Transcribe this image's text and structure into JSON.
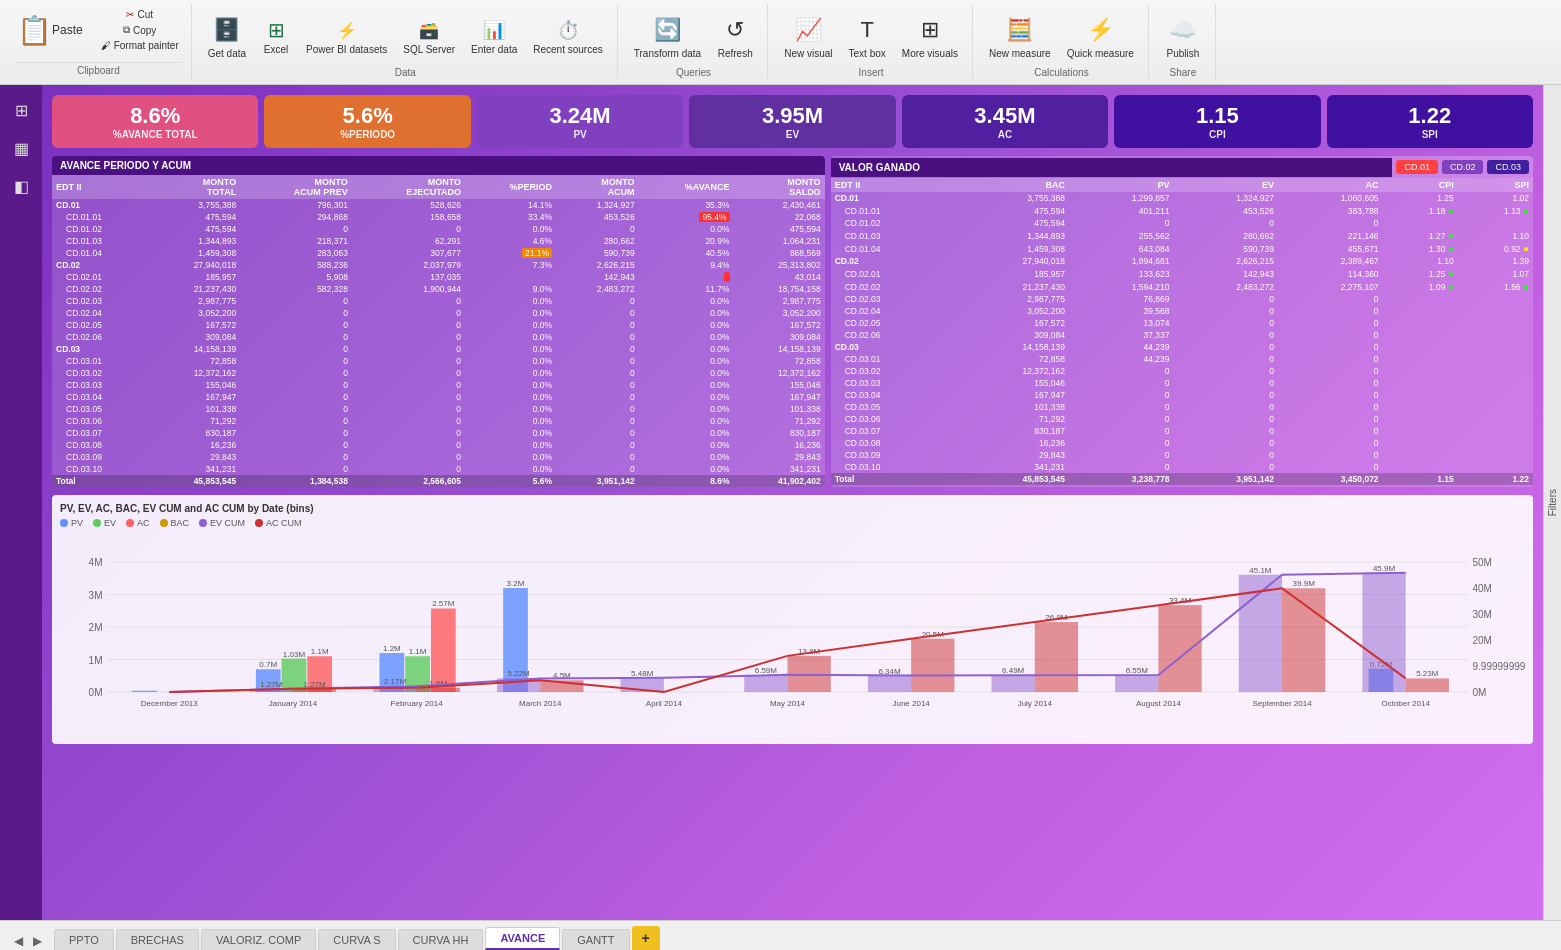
{
  "toolbar": {
    "clipboard_group": "Clipboard",
    "paste_label": "Paste",
    "cut_label": "Cut",
    "copy_label": "Copy",
    "format_painter_label": "Format painter",
    "data_group": "Data",
    "get_data_label": "Get\ndata",
    "excel_label": "Excel",
    "power_bi_label": "Power BI\ndatasets",
    "sql_label": "SQL\nServer",
    "enter_data_label": "Enter\ndata",
    "recent_sources_label": "Recent\nsources",
    "queries_group": "Queries",
    "transform_label": "Transform\ndata",
    "refresh_label": "Refresh",
    "insert_group": "Insert",
    "new_visual_label": "New\nvisual",
    "text_box_label": "Text\nbox",
    "more_visuals_label": "More\nvisuals",
    "calculations_group": "Calculations",
    "new_measure_label": "New\nmeasure",
    "quick_measure_label": "Quick\nmeasure",
    "share_group": "Share",
    "publish_label": "Publish",
    "filters_label": "Filters"
  },
  "kpis": [
    {
      "value": "8.6%",
      "label": "%AVANCE TOTAL",
      "style": "pink"
    },
    {
      "value": "5.6%",
      "label": "%PERIODO",
      "style": "orange"
    },
    {
      "value": "3.24M",
      "label": "PV",
      "style": "purple-light"
    },
    {
      "value": "3.95M",
      "label": "EV",
      "style": "purple-mid"
    },
    {
      "value": "3.45M",
      "label": "AC",
      "style": "purple-dark"
    },
    {
      "value": "1.15",
      "label": "CPI",
      "style": "deep"
    },
    {
      "value": "1.22",
      "label": "SPI",
      "style": "deep"
    }
  ],
  "left_table": {
    "title": "AVANCE PERIODO Y ACUM",
    "headers": [
      "EDT II",
      "MONTO TOTAL",
      "MONTO ACUM PREV",
      "MONTO EJECUTADO",
      "%PERIOD",
      "MONTO ACUM",
      "%AVANCE",
      "MONTO SALDO"
    ],
    "rows": [
      {
        "id": "CD.01",
        "total": "3,755,388",
        "acum_prev": "796,301",
        "ejecutado": "528,626",
        "period": "14.1%",
        "acum": "1,324,927",
        "avance": "35.3%",
        "saldo": "2,430,461",
        "level": 0
      },
      {
        "id": "CD.01.01",
        "total": "475,594",
        "acum_prev": "294,868",
        "ejecutado": "158,658",
        "period": "33.4%",
        "acum": "453,526",
        "avance": "95.4%",
        "saldo": "22,068",
        "level": 1,
        "badge_avance": "red"
      },
      {
        "id": "CD.01.02",
        "total": "475,594",
        "acum_prev": "0",
        "ejecutado": "0",
        "period": "0.0%",
        "acum": "0",
        "avance": "0.0%",
        "saldo": "475,594",
        "level": 1
      },
      {
        "id": "CD.01.03",
        "total": "1,344,893",
        "acum_prev": "218,371",
        "ejecutado": "62,291",
        "period": "4.6%",
        "acum": "280,662",
        "avance": "20.9%",
        "saldo": "1,064,231",
        "level": 1
      },
      {
        "id": "CD.01.04",
        "total": "1,459,308",
        "acum_prev": "283,063",
        "ejecutado": "307,677",
        "period": "21.1%",
        "acum": "590,739",
        "avance": "40.5%",
        "saldo": "868,569",
        "level": 1,
        "badge_period": "orange"
      },
      {
        "id": "CD.02",
        "total": "27,940,018",
        "acum_prev": "588,236",
        "ejecutado": "2,037,979",
        "period": "7.3%",
        "acum": "2,626,215",
        "avance": "9.4%",
        "saldo": "25,313,802",
        "level": 0
      },
      {
        "id": "CD.02.01",
        "total": "185,957",
        "acum_prev": "5,908",
        "ejecutado": "137,035",
        "period": "",
        "acum": "142,943",
        "avance": "",
        "saldo": "43,014",
        "level": 1,
        "badge_avance": "red"
      },
      {
        "id": "CD.02.02",
        "total": "21,237,430",
        "acum_prev": "582,328",
        "ejecutado": "1,900,944",
        "period": "9.0%",
        "acum": "2,483,272",
        "avance": "11.7%",
        "saldo": "18,754,158",
        "level": 1
      },
      {
        "id": "CD.02.03",
        "total": "2,987,775",
        "acum_prev": "0",
        "ejecutado": "0",
        "period": "0.0%",
        "acum": "0",
        "avance": "0.0%",
        "saldo": "2,987,775",
        "level": 1
      },
      {
        "id": "CD.02.04",
        "total": "3,052,200",
        "acum_prev": "0",
        "ejecutado": "0",
        "period": "0.0%",
        "acum": "0",
        "avance": "0.0%",
        "saldo": "3,052,200",
        "level": 1
      },
      {
        "id": "CD.02.05",
        "total": "167,572",
        "acum_prev": "0",
        "ejecutado": "0",
        "period": "0.0%",
        "acum": "0",
        "avance": "0.0%",
        "saldo": "167,572",
        "level": 1
      },
      {
        "id": "CD.02.06",
        "total": "309,084",
        "acum_prev": "0",
        "ejecutado": "0",
        "period": "0.0%",
        "acum": "0",
        "avance": "0.0%",
        "saldo": "309,084",
        "level": 1
      },
      {
        "id": "CD.03",
        "total": "14,158,139",
        "acum_prev": "0",
        "ejecutado": "0",
        "period": "0.0%",
        "acum": "0",
        "avance": "0.0%",
        "saldo": "14,158,139",
        "level": 0
      },
      {
        "id": "CD.03.01",
        "total": "72,858",
        "acum_prev": "0",
        "ejecutado": "0",
        "period": "0.0%",
        "acum": "0",
        "avance": "0.0%",
        "saldo": "72,858",
        "level": 1
      },
      {
        "id": "CD.03.02",
        "total": "12,372,162",
        "acum_prev": "0",
        "ejecutado": "0",
        "period": "0.0%",
        "acum": "0",
        "avance": "0.0%",
        "saldo": "12,372,162",
        "level": 1
      },
      {
        "id": "CD.03.03",
        "total": "155,046",
        "acum_prev": "0",
        "ejecutado": "0",
        "period": "0.0%",
        "acum": "0",
        "avance": "0.0%",
        "saldo": "155,046",
        "level": 1
      },
      {
        "id": "CD.03.04",
        "total": "167,947",
        "acum_prev": "0",
        "ejecutado": "0",
        "period": "0.0%",
        "acum": "0",
        "avance": "0.0%",
        "saldo": "167,947",
        "level": 1
      },
      {
        "id": "CD.03.05",
        "total": "101,338",
        "acum_prev": "0",
        "ejecutado": "0",
        "period": "0.0%",
        "acum": "0",
        "avance": "0.0%",
        "saldo": "101,338",
        "level": 1
      },
      {
        "id": "CD.03.06",
        "total": "71,292",
        "acum_prev": "0",
        "ejecutado": "0",
        "period": "0.0%",
        "acum": "0",
        "avance": "0.0%",
        "saldo": "71,292",
        "level": 1
      },
      {
        "id": "CD.03.07",
        "total": "830,187",
        "acum_prev": "0",
        "ejecutado": "0",
        "period": "0.0%",
        "acum": "0",
        "avance": "0.0%",
        "saldo": "830,187",
        "level": 1
      },
      {
        "id": "CD.03.08",
        "total": "16,236",
        "acum_prev": "0",
        "ejecutado": "0",
        "period": "0.0%",
        "acum": "0",
        "avance": "0.0%",
        "saldo": "16,236",
        "level": 1
      },
      {
        "id": "CD.03.09",
        "total": "29,843",
        "acum_prev": "0",
        "ejecutado": "0",
        "period": "0.0%",
        "acum": "0",
        "avance": "0.0%",
        "saldo": "29,843",
        "level": 1
      },
      {
        "id": "CD.03.10",
        "total": "341,231",
        "acum_prev": "0",
        "ejecutado": "0",
        "period": "0.0%",
        "acum": "0",
        "avance": "0.0%",
        "saldo": "341,231",
        "level": 1
      }
    ],
    "total_row": {
      "id": "Total",
      "total": "45,853,545",
      "acum_prev": "1,384,538",
      "ejecutado": "2,566,605",
      "period": "5.6%",
      "acum": "3,951,142",
      "avance": "8.6%",
      "saldo": "41,902,402"
    }
  },
  "right_table": {
    "title": "VALOR GANADO",
    "cd_buttons": [
      "CD.01",
      "CD.02",
      "CD.03"
    ],
    "headers": [
      "EDT II",
      "BAC",
      "PV",
      "EV",
      "AC",
      "CPI",
      "SPI"
    ],
    "rows": [
      {
        "id": "CD.01",
        "bac": "3,755,388",
        "pv": "1,299,857",
        "ev": "1,324,927",
        "ac": "1,060,605",
        "cpi": "1.25",
        "spi": "1.02",
        "level": 0,
        "dot_cpi": "",
        "dot_spi": ""
      },
      {
        "id": "CD.01.01",
        "bac": "475,594",
        "pv": "401,211",
        "ev": "453,526",
        "ac": "383,788",
        "cpi": "1.18",
        "spi": "1.13",
        "level": 1,
        "dot_cpi": "green",
        "dot_spi": "green"
      },
      {
        "id": "CD.01.02",
        "bac": "475,594",
        "pv": "0",
        "ev": "0",
        "ac": "0",
        "cpi": "",
        "spi": "",
        "level": 1
      },
      {
        "id": "CD.01.03",
        "bac": "1,344,893",
        "pv": "255,562",
        "ev": "280,662",
        "ac": "221,146",
        "cpi": "1.27",
        "spi": "1.10",
        "level": 1,
        "dot_cpi": "green",
        "dot_spi": ""
      },
      {
        "id": "CD.01.04",
        "bac": "1,459,308",
        "pv": "643,084",
        "ev": "590,739",
        "ac": "455,671",
        "cpi": "1.30",
        "spi": "0.92",
        "level": 1,
        "dot_cpi": "green",
        "dot_spi": "yellow"
      },
      {
        "id": "CD.02",
        "bac": "27,940,018",
        "pv": "1,894,681",
        "ev": "2,626,215",
        "ac": "2,389,467",
        "cpi": "1.10",
        "spi": "1.39",
        "level": 0
      },
      {
        "id": "CD.02.01",
        "bac": "185,957",
        "pv": "133,623",
        "ev": "142,943",
        "ac": "114,360",
        "cpi": "1.25",
        "spi": "1.07",
        "level": 1,
        "dot_cpi": "green",
        "dot_spi": ""
      },
      {
        "id": "CD.02.02",
        "bac": "21,237,430",
        "pv": "1,594,210",
        "ev": "2,483,272",
        "ac": "2,275,107",
        "cpi": "1.09",
        "spi": "1.56",
        "level": 1,
        "dot_cpi": "green",
        "dot_spi": "green"
      },
      {
        "id": "CD.02.03",
        "bac": "2,987,775",
        "pv": "76,869",
        "ev": "0",
        "ac": "0",
        "cpi": "",
        "spi": "",
        "level": 1
      },
      {
        "id": "CD.02.04",
        "bac": "3,052,200",
        "pv": "39,568",
        "ev": "0",
        "ac": "0",
        "cpi": "",
        "spi": "",
        "level": 1
      },
      {
        "id": "CD.02.05",
        "bac": "167,572",
        "pv": "13,074",
        "ev": "0",
        "ac": "0",
        "cpi": "",
        "spi": "",
        "level": 1
      },
      {
        "id": "CD.02.06",
        "bac": "309,084",
        "pv": "37,337",
        "ev": "0",
        "ac": "0",
        "cpi": "",
        "spi": "",
        "level": 1
      },
      {
        "id": "CD.03",
        "bac": "14,158,139",
        "pv": "44,239",
        "ev": "0",
        "ac": "0",
        "cpi": "",
        "spi": "",
        "level": 0
      },
      {
        "id": "CD.03.01",
        "bac": "72,858",
        "pv": "44,239",
        "ev": "0",
        "ac": "0",
        "cpi": "",
        "spi": "",
        "level": 1
      },
      {
        "id": "CD.03.02",
        "bac": "12,372,162",
        "pv": "0",
        "ev": "0",
        "ac": "0",
        "cpi": "",
        "spi": "",
        "level": 1
      },
      {
        "id": "CD.03.03",
        "bac": "155,046",
        "pv": "0",
        "ev": "0",
        "ac": "0",
        "cpi": "",
        "spi": "",
        "level": 1
      },
      {
        "id": "CD.03.04",
        "bac": "167,947",
        "pv": "0",
        "ev": "0",
        "ac": "0",
        "cpi": "",
        "spi": "",
        "level": 1
      },
      {
        "id": "CD.03.05",
        "bac": "101,338",
        "pv": "0",
        "ev": "0",
        "ac": "0",
        "cpi": "",
        "spi": "",
        "level": 1
      },
      {
        "id": "CD.03.06",
        "bac": "71,292",
        "pv": "0",
        "ev": "0",
        "ac": "0",
        "cpi": "",
        "spi": "",
        "level": 1
      },
      {
        "id": "CD.03.07",
        "bac": "830,187",
        "pv": "0",
        "ev": "0",
        "ac": "0",
        "cpi": "",
        "spi": "",
        "level": 1
      },
      {
        "id": "CD.03.08",
        "bac": "16,236",
        "pv": "0",
        "ev": "0",
        "ac": "0",
        "cpi": "",
        "spi": "",
        "level": 1
      },
      {
        "id": "CD.03.09",
        "bac": "29,843",
        "pv": "0",
        "ev": "0",
        "ac": "0",
        "cpi": "",
        "spi": "",
        "level": 1
      },
      {
        "id": "CD.03.10",
        "bac": "341,231",
        "pv": "0",
        "ev": "0",
        "ac": "0",
        "cpi": "",
        "spi": "",
        "level": 1
      }
    ],
    "total_row": {
      "id": "Total",
      "bac": "45,853,545",
      "pv": "3,238,778",
      "ev": "3,951,142",
      "ac": "3,450,072",
      "cpi": "1.15",
      "spi": "1.22"
    }
  },
  "chart": {
    "title": "PV, EV, AC, BAC, EV CUM and AC CUM by Date (bins)",
    "legend": [
      {
        "label": "PV",
        "color": "#6090ff"
      },
      {
        "label": "EV",
        "color": "#60cc60"
      },
      {
        "label": "AC",
        "color": "#ff6060"
      },
      {
        "label": "BAC",
        "color": "#cc9900"
      },
      {
        "label": "EV CUM",
        "color": "#9060d0"
      },
      {
        "label": "AC CUM",
        "color": "#cc3030"
      }
    ],
    "bars": [
      {
        "month": "December 2013",
        "pv": 0.04,
        "ev": 0,
        "ac": 0,
        "bac": 0,
        "ev_cum": 0.04,
        "ac_cum": 0
      },
      {
        "month": "January 2014",
        "pv": 0.7,
        "ev": 1.03,
        "ac": 1.1,
        "bac": 0,
        "ev_cum": 1.27,
        "ac_cum": 1.27
      },
      {
        "month": "February 2014",
        "pv": 1.2,
        "ev": 1.1,
        "ac": 2.57,
        "bac": 0,
        "ev_cum": 2.17,
        "ac_cum": 1.6
      },
      {
        "month": "March 2014",
        "pv": 3.2,
        "ev": 0,
        "ac": 0,
        "bac": 0,
        "ev_cum": 5.22,
        "ac_cum": 4.5
      },
      {
        "month": "April 2014",
        "pv": 0,
        "ev": 0,
        "ac": 0,
        "bac": 0,
        "ev_cum": 5.48,
        "ac_cum": 0
      },
      {
        "month": "May 2014",
        "pv": 0,
        "ev": 0,
        "ac": 0,
        "bac": 0,
        "ev_cum": 6.59,
        "ac_cum": 13.9
      },
      {
        "month": "June 2014",
        "pv": 0,
        "ev": 0,
        "ac": 0,
        "bac": 0,
        "ev_cum": 6.34,
        "ac_cum": 20.5
      },
      {
        "month": "July 2014",
        "pv": 0,
        "ev": 0,
        "ac": 0,
        "bac": 0,
        "ev_cum": 6.49,
        "ac_cum": 26.9
      },
      {
        "month": "August 2014",
        "pv": 0,
        "ev": 0,
        "ac": 0,
        "bac": 0,
        "ev_cum": 6.55,
        "ac_cum": 33.4
      },
      {
        "month": "September 2014",
        "pv": 0,
        "ev": 0,
        "ac": 0,
        "bac": 0,
        "ev_cum": 45.1,
        "ac_cum": 39.9
      },
      {
        "month": "October 2014",
        "pv": 0.72,
        "ev": 0,
        "ac": 0,
        "bac": 0,
        "ev_cum": 45.9,
        "ac_cum": 5.23
      }
    ]
  },
  "bottom_tabs": {
    "tabs": [
      "PPTO",
      "BRECHAS",
      "VALORIZ. COMP",
      "CURVA S",
      "CURVA HH",
      "AVANCE",
      "GANTT"
    ],
    "active_tab": "AVANCE",
    "add_label": "+"
  },
  "sidebar_icons": [
    "grid-icon",
    "table-icon",
    "layers-icon"
  ]
}
